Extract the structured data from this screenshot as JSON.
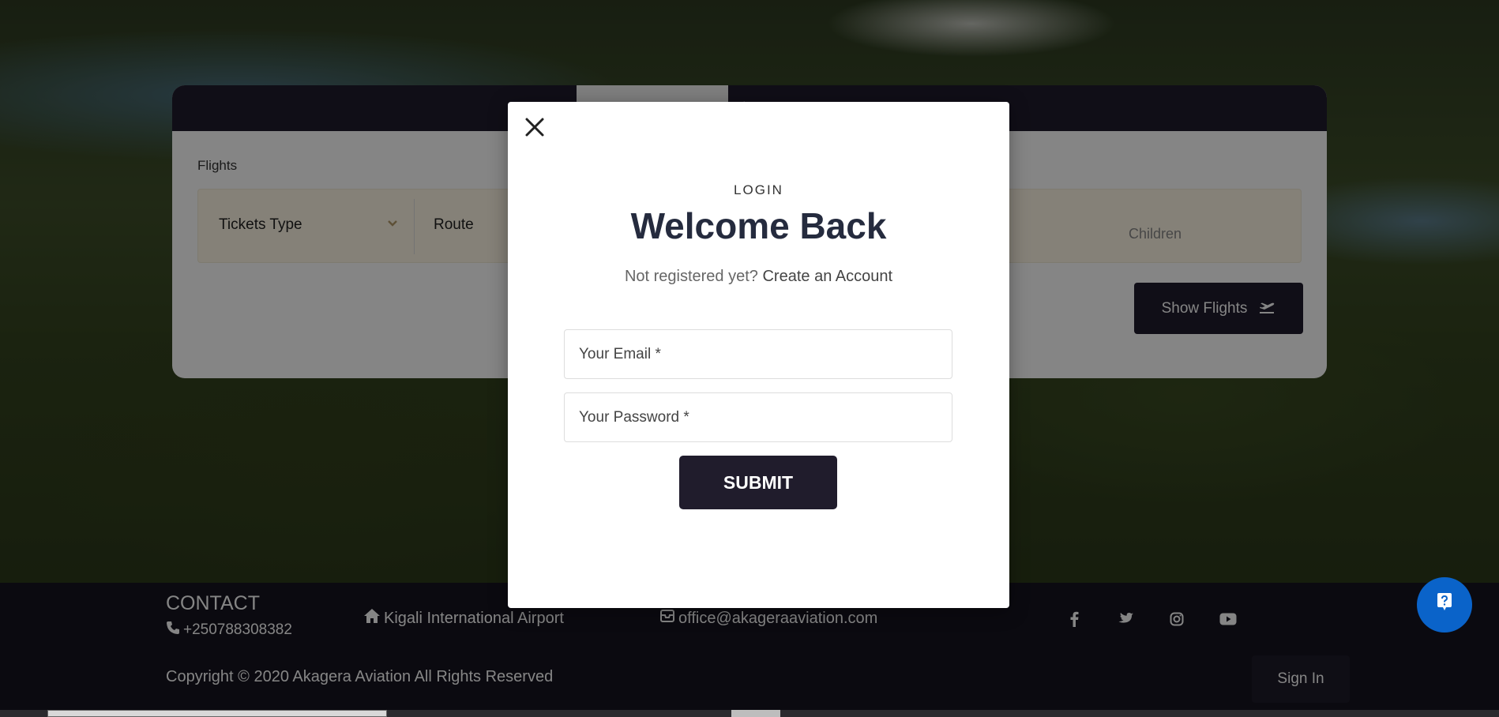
{
  "search": {
    "section_label": "Flights",
    "tickets_type": "Tickets Type",
    "route": "Route",
    "children": "Children",
    "show_flights": "Show Flights"
  },
  "modal": {
    "eyebrow": "LOGIN",
    "title": "Welcome Back",
    "subtitle_prefix": "Not registered yet?",
    "create_account": "Create an Account",
    "email_placeholder": "Your Email *",
    "password_placeholder": "Your Password *",
    "submit": "SUBMIT"
  },
  "footer": {
    "contact_title": "CONTACT",
    "phone": "+250788308382",
    "address": "Kigali International Airport",
    "email": "office@akageraaviation.com",
    "copyright": "Copyright © 2020 Akagera Aviation All Rights Reserved",
    "sign_in": "Sign In",
    "social": [
      "facebook-icon",
      "twitter-icon",
      "instagram-icon",
      "youtube-icon"
    ]
  },
  "colors": {
    "primary_dark": "#201c2c",
    "heading": "#252b3e",
    "help_blue": "#0a63c9",
    "search_bar_bg": "#fff8e7"
  }
}
